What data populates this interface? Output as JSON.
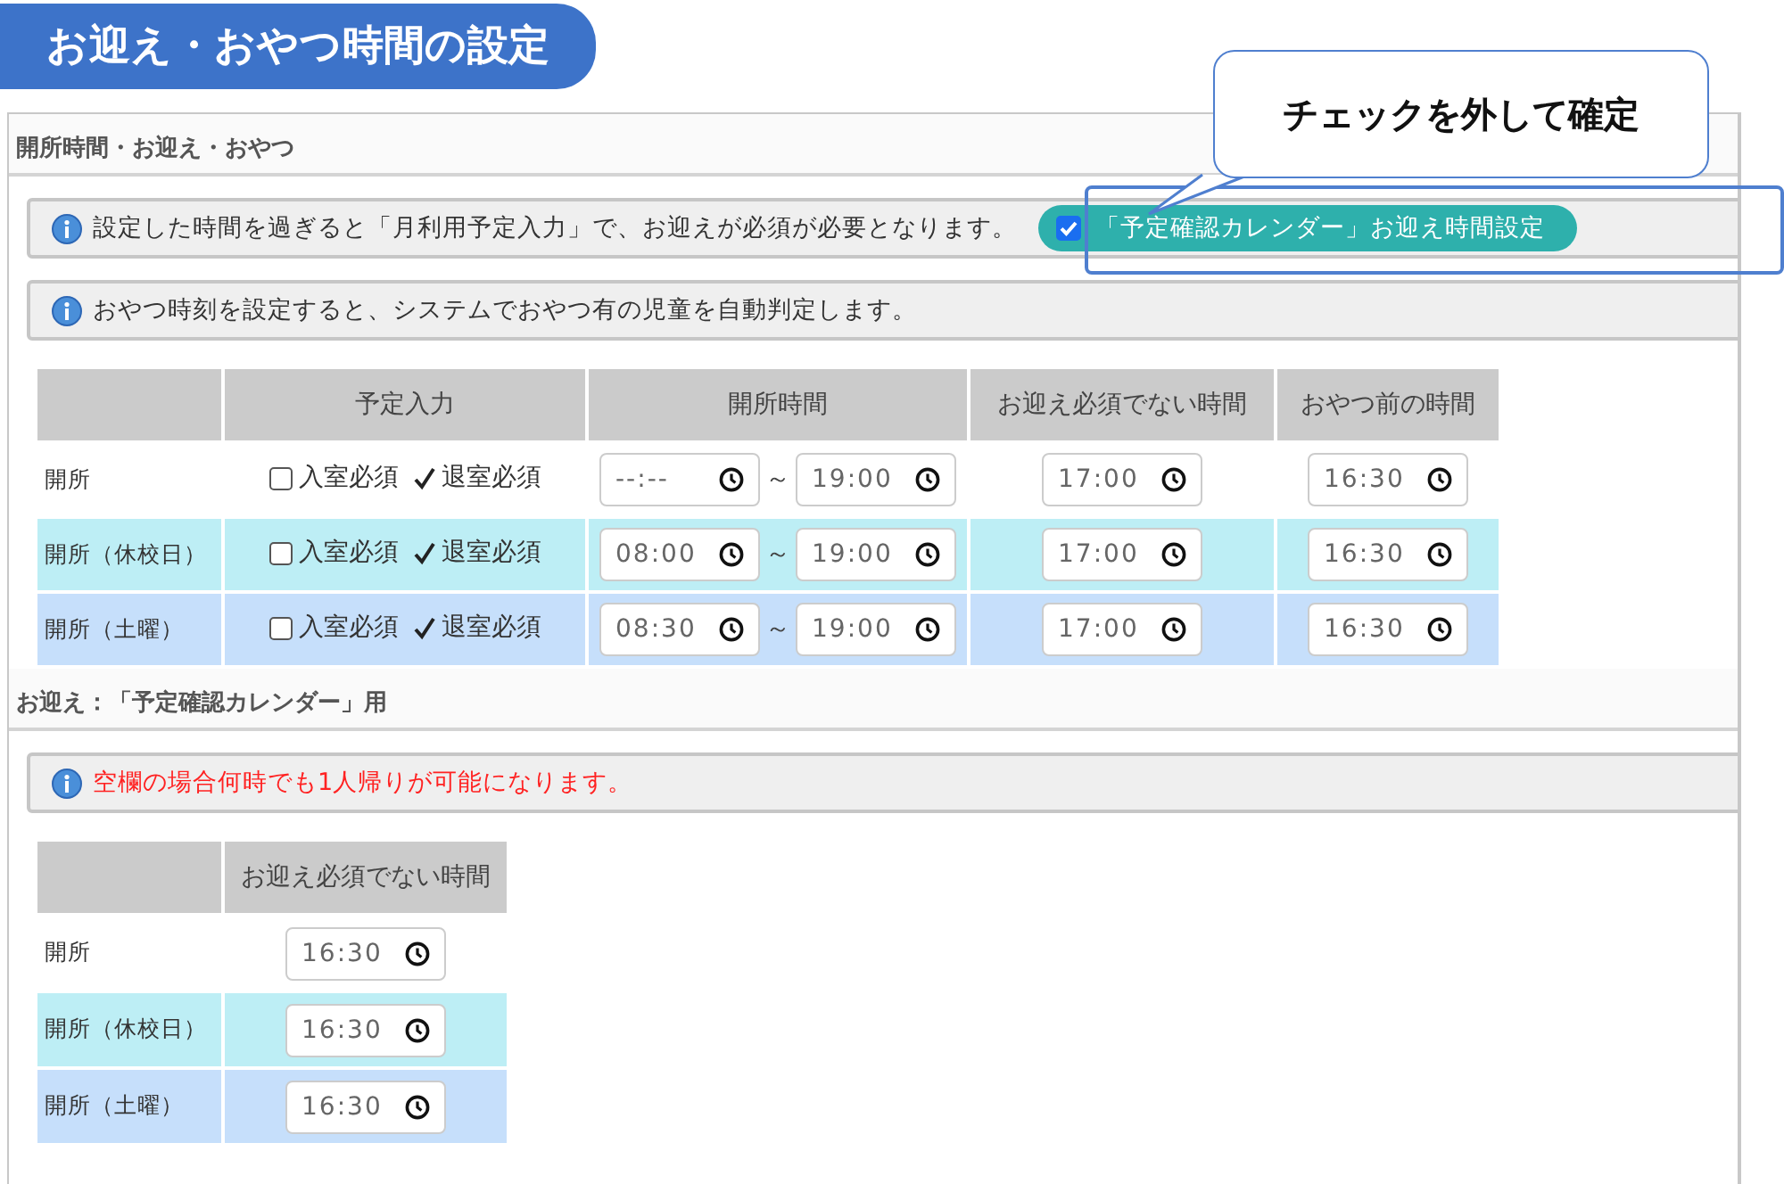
{
  "page_title": "お迎え・おやつ時間の設定",
  "callout": {
    "text": "チェックを外して確定"
  },
  "hours_section": {
    "title": "開所時間・お迎え・おやつ",
    "notices": [
      {
        "kind": "info",
        "text": "設定した時間を過ぎると「月利用予定入力」で、お迎えが必須が必要となります。",
        "toggle": {
          "label": "「予定確認カレンダー」お迎え時間設定",
          "checked": true
        }
      },
      {
        "kind": "info",
        "text": "おやつ時刻を設定すると、システムでおやつ有の児童を自動判定します。"
      }
    ],
    "table": {
      "columns": [
        "予定入力",
        "開所時間",
        "お迎え必須でない時間",
        "おやつ前の時間"
      ],
      "rows": [
        {
          "label": "開所",
          "color": "#ffffff",
          "entry_in": {
            "label": "入室必須",
            "checked": false
          },
          "entry_out": {
            "label": "退室必須",
            "checked": true
          },
          "open_from": "--:--",
          "separator": "～",
          "open_to": "19:00",
          "pickup_time": "17:00",
          "snack_time": "16:30"
        },
        {
          "label": "開所（休校日）",
          "color": "#bdeef5",
          "entry_in": {
            "label": "入室必須",
            "checked": false
          },
          "entry_out": {
            "label": "退室必須",
            "checked": true
          },
          "open_from": "08:00",
          "separator": "～",
          "open_to": "19:00",
          "pickup_time": "17:00",
          "snack_time": "16:30"
        },
        {
          "label": "開所（土曜）",
          "color": "#c6dffb",
          "entry_in": {
            "label": "入室必須",
            "checked": false
          },
          "entry_out": {
            "label": "退室必須",
            "checked": true
          },
          "open_from": "08:30",
          "separator": "～",
          "open_to": "19:00",
          "pickup_time": "17:00",
          "snack_time": "16:30"
        }
      ]
    }
  },
  "pickup_section": {
    "title": "お迎え：「予定確認カレンダー」用",
    "notices": [
      {
        "kind": "alert",
        "text": "空欄の場合何時でも1人帰りが可能になります。"
      }
    ],
    "table": {
      "columns": [
        "お迎え必須でない時間"
      ],
      "rows": [
        {
          "label": "開所",
          "color": "#ffffff",
          "pickup_time": "16:30"
        },
        {
          "label": "開所（休校日）",
          "color": "#bdeef5",
          "pickup_time": "16:30"
        },
        {
          "label": "開所（土曜）",
          "color": "#c6dffb",
          "pickup_time": "16:30"
        }
      ]
    }
  }
}
